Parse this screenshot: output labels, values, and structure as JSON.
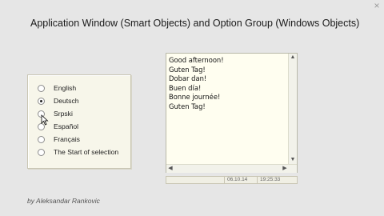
{
  "window": {
    "title": "Application Window (Smart Objects) and Option Group (Windows Objects)",
    "close_glyph": "×"
  },
  "option_group": {
    "selected": "Deutsch",
    "options": [
      {
        "label": "English",
        "checked": false
      },
      {
        "label": "Deutsch",
        "checked": true
      },
      {
        "label": "Srpski",
        "checked": false
      },
      {
        "label": "Español",
        "checked": false
      },
      {
        "label": "Français",
        "checked": false
      },
      {
        "label": "The Start of selection",
        "checked": false
      }
    ]
  },
  "text_area": {
    "lines": [
      "Good afternoon!",
      "Guten Tag!",
      "Dobar dan!",
      "Buen día!",
      "Bonne journée!",
      "Guten Tag!"
    ]
  },
  "status_bar": {
    "date": "06.10.14",
    "time": "19:25:33"
  },
  "footer": {
    "author": "by Aleksandar Rankovic"
  },
  "colors": {
    "background": "#e6e6e6",
    "panel": "#f7f6ea",
    "text_area_bg": "#fffef0"
  }
}
